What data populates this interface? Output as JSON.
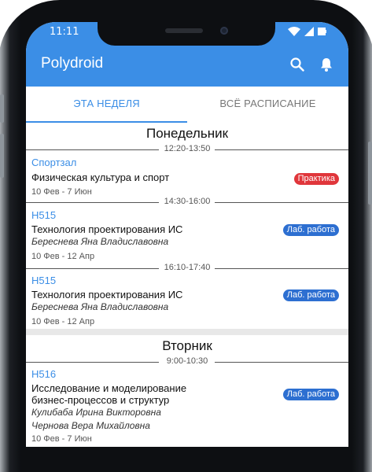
{
  "status_bar": {
    "time": "11:11"
  },
  "app": {
    "title": "Polydroid"
  },
  "icons": {
    "search": "search-icon",
    "notifications": "bell-icon"
  },
  "colors": {
    "accent": "#3b8ee6",
    "badge_practice": "#e0363b",
    "badge_lab": "#2d6fd1"
  },
  "tabs": [
    {
      "label": "ЭТА НЕДЕЛЯ",
      "active": true
    },
    {
      "label": "ВСЁ РАСПИСАНИЕ",
      "active": false
    }
  ],
  "days": [
    {
      "name": "Понедельник",
      "lessons": [
        {
          "time": "12:20-13:50",
          "room": "Спортзал",
          "subject": "Физическая культура и спорт",
          "teacher": "",
          "dates": "10 Фев - 7 Июн",
          "type": "Практика"
        },
        {
          "time": "14:30-16:00",
          "room": "Н515",
          "subject": "Технология проектирования ИС",
          "teacher": "Береснева Яна Владиславовна",
          "dates": "10 Фев - 12 Апр",
          "type": "Лаб. работа"
        },
        {
          "time": "16:10-17:40",
          "room": "Н515",
          "subject": "Технология проектирования ИС",
          "teacher": "Береснева Яна Владиславовна",
          "dates": "10 Фев - 12 Апр",
          "type": "Лаб. работа"
        }
      ]
    },
    {
      "name": "Вторник",
      "lessons": [
        {
          "time": "9:00-10:30",
          "room": "Н516",
          "subject_line1": "Исследование и моделирование",
          "subject_line2": "бизнес-процессов и структур",
          "teacher1": "Кулибаба Ирина Викторовна",
          "teacher2": "Чернова Вера Михайловна",
          "dates": "10 Фев - 7 Июн",
          "type": "Лаб. работа"
        }
      ]
    }
  ]
}
